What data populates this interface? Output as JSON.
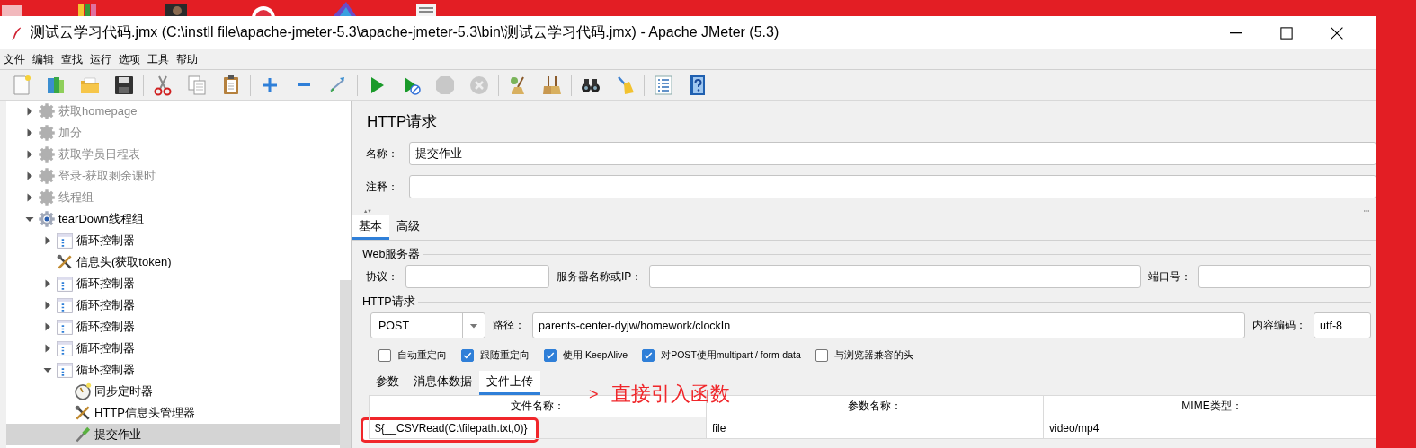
{
  "window": {
    "title": "测试云学习代码.jmx (C:\\instll file\\apache-jmeter-5.3\\apache-jmeter-5.3\\bin\\测试云学习代码.jmx) - Apache JMeter (5.3)"
  },
  "menu": [
    "文件",
    "编辑",
    "查找",
    "运行",
    "选项",
    "工具",
    "帮助"
  ],
  "toolbar": [
    {
      "kind": "new",
      "disabled": false
    },
    {
      "kind": "templates",
      "disabled": false
    },
    {
      "kind": "open",
      "disabled": false
    },
    {
      "kind": "save",
      "disabled": false
    },
    {
      "kind": "separator"
    },
    {
      "kind": "cut",
      "disabled": false
    },
    {
      "kind": "copy",
      "disabled": false
    },
    {
      "kind": "paste",
      "disabled": false
    },
    {
      "kind": "separator"
    },
    {
      "kind": "expand",
      "disabled": false
    },
    {
      "kind": "collapse",
      "disabled": false
    },
    {
      "kind": "toggle",
      "disabled": false
    },
    {
      "kind": "separator"
    },
    {
      "kind": "start",
      "disabled": false
    },
    {
      "kind": "start-no-pause",
      "disabled": false
    },
    {
      "kind": "stop",
      "disabled": true
    },
    {
      "kind": "shutdown",
      "disabled": true
    },
    {
      "kind": "separator"
    },
    {
      "kind": "clear",
      "disabled": false
    },
    {
      "kind": "clear-all",
      "disabled": false
    },
    {
      "kind": "separator"
    },
    {
      "kind": "search",
      "disabled": false
    },
    {
      "kind": "reset",
      "disabled": false
    },
    {
      "kind": "separator"
    },
    {
      "kind": "function",
      "disabled": false
    },
    {
      "kind": "help",
      "disabled": false
    }
  ],
  "tree": [
    {
      "label": "获取homepage",
      "kind": "thread-group",
      "expanded": false,
      "disabled": true,
      "selected": false
    },
    {
      "label": "加分",
      "kind": "thread-group",
      "expanded": false,
      "disabled": true,
      "selected": false
    },
    {
      "label": "获取学员日程表",
      "kind": "thread-group",
      "expanded": false,
      "disabled": true,
      "selected": false
    },
    {
      "label": "登录-获取剩余课时",
      "kind": "thread-group",
      "expanded": false,
      "disabled": true,
      "selected": false
    },
    {
      "label": "线程组",
      "kind": "thread-group",
      "expanded": false,
      "disabled": true,
      "selected": false
    },
    {
      "label": "tearDown线程组",
      "kind": "teardown-group",
      "expanded": true,
      "disabled": false,
      "selected": false,
      "children": [
        {
          "label": "循环控制器",
          "kind": "loop",
          "expanded": false,
          "disabled": false,
          "selected": false
        },
        {
          "label": "信息头(获取token)",
          "kind": "header",
          "disabled": false,
          "selected": false
        },
        {
          "label": "循环控制器",
          "kind": "loop",
          "expanded": false,
          "disabled": false,
          "selected": false
        },
        {
          "label": "循环控制器",
          "kind": "loop",
          "expanded": false,
          "disabled": false,
          "selected": false
        },
        {
          "label": "循环控制器",
          "kind": "loop",
          "expanded": false,
          "disabled": false,
          "selected": false
        },
        {
          "label": "循环控制器",
          "kind": "loop",
          "expanded": false,
          "disabled": false,
          "selected": false
        },
        {
          "label": "循环控制器",
          "kind": "loop",
          "expanded": true,
          "disabled": false,
          "selected": false,
          "children": [
            {
              "label": "同步定时器",
              "kind": "timer",
              "disabled": false,
              "selected": false
            },
            {
              "label": "HTTP信息头管理器",
              "kind": "header",
              "disabled": false,
              "selected": false
            },
            {
              "label": "提交作业",
              "kind": "sampler",
              "disabled": false,
              "selected": true
            }
          ]
        }
      ]
    }
  ],
  "editor": {
    "title": "HTTP请求",
    "name": {
      "label": "名称：",
      "value": "提交作业"
    },
    "comment": {
      "label": "注释："
    },
    "tabs": [
      {
        "label": "基本",
        "selected": true
      },
      {
        "label": "高级",
        "selected": false
      }
    ],
    "web_server": {
      "title": "Web服务器",
      "protocol": {
        "label": "协议："
      },
      "server": {
        "label": "服务器名称或IP："
      },
      "port": {
        "label": "端口号："
      }
    },
    "http_request": {
      "title": "HTTP请求",
      "method": "POST",
      "path": {
        "label": "路径：",
        "value": "parents-center-dyjw/homework/clockIn"
      },
      "encoding": {
        "label": "内容编码：",
        "value": "utf-8"
      }
    },
    "options": [
      {
        "label": "自动重定向",
        "checked": false
      },
      {
        "label": "跟随重定向",
        "checked": true
      },
      {
        "label": "使用 KeepAlive",
        "checked": true
      },
      {
        "label": "对POST使用multipart / form-data",
        "checked": true
      },
      {
        "label": "与浏览器兼容的头",
        "checked": false
      }
    ],
    "sub_tabs": [
      {
        "label": "参数",
        "selected": false
      },
      {
        "label": "消息体数据",
        "selected": false
      },
      {
        "label": "文件上传",
        "selected": true
      }
    ],
    "files_table": {
      "columns": [
        "文件名称：",
        "参数名称：",
        "MIME类型："
      ],
      "rows": [
        [
          "${__CSVRead(C:\\filepath.txt,0)}",
          "file",
          "video/mp4"
        ]
      ]
    },
    "annotation": {
      "arrow": ">",
      "text": "直接引入函数"
    }
  }
}
